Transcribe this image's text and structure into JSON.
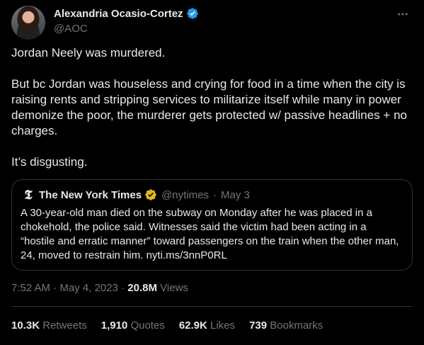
{
  "author": {
    "display_name": "Alexandria Ocasio-Cortez",
    "handle": "@AOC",
    "verified": true
  },
  "tweet": {
    "paragraphs": [
      "Jordan Neely was murdered.",
      "But bc Jordan was houseless and crying for food in a time when the city is raising rents and stripping services to militarize itself while many in power demonize the poor, the murderer gets protected w/ passive headlines + no charges.",
      "It’s disgusting."
    ],
    "time": "7:52 AM",
    "date": "May 4, 2023",
    "views_count": "20.8M",
    "views_label": "Views"
  },
  "quote": {
    "name": "The New York Times",
    "handle": "@nytimes",
    "date": "May 3",
    "text": "A 30-year-old man died on the subway on Monday after he was placed in a chokehold, the police said. Witnesses said the victim had been acting in a “hostile and erratic manner” toward passengers on the train when the other man, 24, moved to restrain him. nyti.ms/3nnP0RL"
  },
  "stats": {
    "retweets": {
      "count": "10.3K",
      "label": "Retweets"
    },
    "quotes": {
      "count": "1,910",
      "label": "Quotes"
    },
    "likes": {
      "count": "62.9K",
      "label": "Likes"
    },
    "bookmarks": {
      "count": "739",
      "label": "Bookmarks"
    }
  },
  "colors": {
    "background": "#000000",
    "text": "#e7e9ea",
    "secondary": "#71767b",
    "border": "#2f3336",
    "verified_blue": "#1d9bf0",
    "verified_gold": "#e2b719"
  },
  "icons": {
    "verified": "verified-badge-icon",
    "more": "more-options-icon",
    "nyt": "nyt-logo-icon",
    "gold": "gold-verified-badge-icon"
  }
}
